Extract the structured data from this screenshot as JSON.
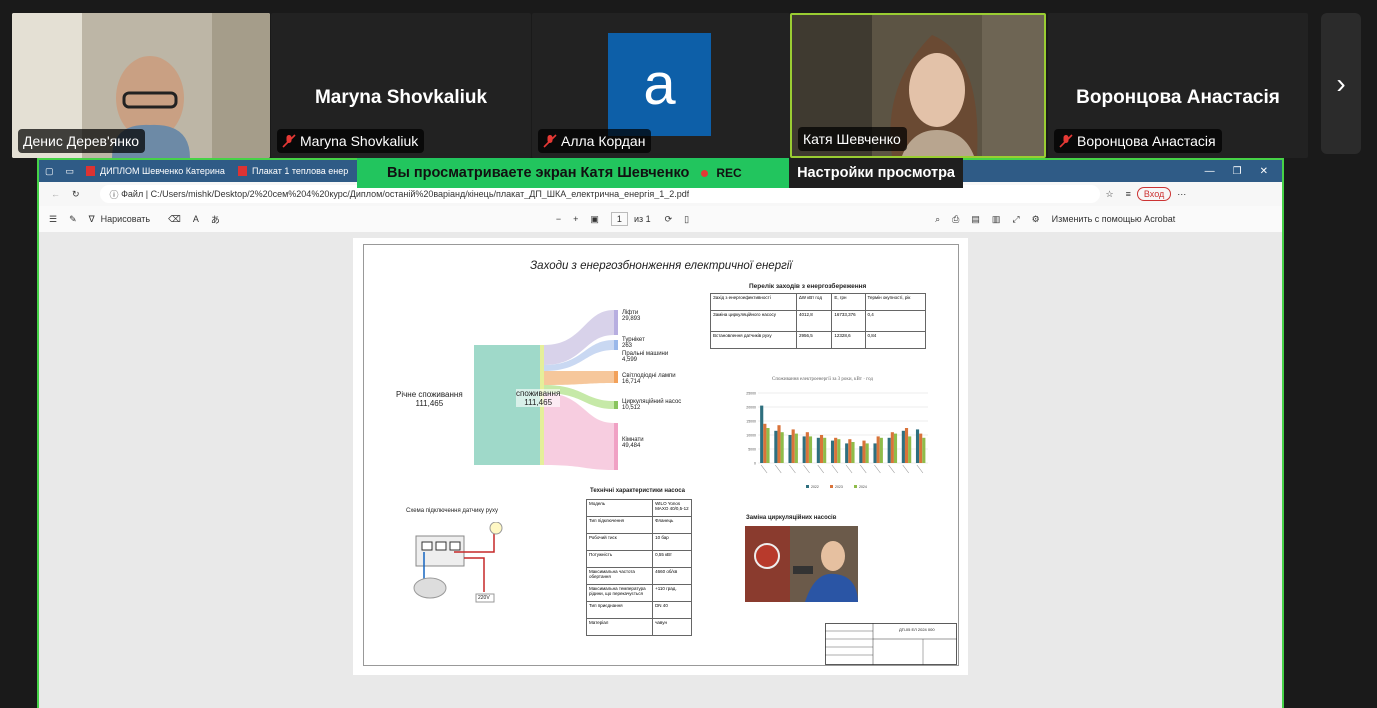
{
  "participants": [
    {
      "name": "Денис Дерев'янко",
      "muted": false
    },
    {
      "name": "Maryna Shovkaliuk",
      "muted": true,
      "display": "Maryna Shovkaliuk"
    },
    {
      "name": "Алла Кордан",
      "muted": true,
      "avatar_letter": "a"
    },
    {
      "name": "Катя Шевченко",
      "muted": false
    },
    {
      "name": "Воронцова Анастасія",
      "muted": true,
      "display": "Воронцова Анастасія"
    }
  ],
  "next_icon": "chevron-right-icon",
  "banner": {
    "text": "Вы просматриваете экран  Катя Шевченко",
    "rec": "REC",
    "settings": "Настройки просмотра"
  },
  "browser": {
    "tabs": [
      "ДИПЛОМ Шевченко Катерина",
      "Плакат 1 теплова енер"
    ],
    "url_label": "Файл",
    "url": "C:/Users/mishk/Desktop/2%20сем%204%20курс/Диплом/останій%20варіанд/кінець/плакат_ДП_ШКА_електрична_енергія_1_2.pdf",
    "login": "Вход"
  },
  "pdf_toolbar": {
    "draw": "Нарисовать",
    "page": "1",
    "of": "из 1",
    "edit": "Изменить с помощью Acrobat"
  },
  "poster": {
    "title": "Заходи з енергозбнонження електричної енергії",
    "sankey": {
      "left_label": "Річне споживання",
      "left_value": "111,465",
      "mid_label": "споживання",
      "mid_value": "111,465",
      "items": [
        {
          "label": "Ліфти",
          "value": "29,893"
        },
        {
          "label": "Турнікет",
          "value": "263"
        },
        {
          "label": "Пральні машини",
          "value": "4,599"
        },
        {
          "label": "Світлодіодні лампи",
          "value": "16,714"
        },
        {
          "label": "Циркуляційний насос",
          "value": "10,512"
        },
        {
          "label": "Кімнати",
          "value": "49,484"
        }
      ]
    },
    "measures": {
      "title": "Перелік заходів з енергозбереження",
      "headers": [
        "Захід з енергоефективності",
        "∆W кВт год",
        "Е, грн",
        "Термін окупності, рік"
      ],
      "rows": [
        [
          "Заміна циркуляційного насосу",
          "4012,8",
          "16733,376",
          "0,4"
        ],
        [
          "Встановлення датчиків руху",
          "2956,5",
          "12328,6",
          "0,84"
        ]
      ]
    },
    "chart_title": "Споживання електроенергії за 3 роки, кВт · год",
    "chart_legend": [
      "2022",
      "2023",
      "2024"
    ],
    "pump": {
      "title": "Технічні характеристики насоса",
      "rows": [
        [
          "Модель",
          "WILO Yonos MAXO 40/0,5-12"
        ],
        [
          "Тип підключення",
          "Фланець"
        ],
        [
          "Робочий тиск",
          "10 бар"
        ],
        [
          "Потужність",
          "0,55 кВт"
        ],
        [
          "Максимальна частота обертання",
          "4660 об/хв"
        ],
        [
          "Максимальна температура рідини, що перекачується",
          "+110 град."
        ],
        [
          "Тип приєднання",
          "DN 40"
        ],
        [
          "Матеріал",
          "чавун"
        ]
      ]
    },
    "sensor_title": "Схема підключення датчику руху",
    "sensor_voltage": "220V",
    "replace_title": "Заміна циркуляційних насосів",
    "stamp_code": "ДП-05 ЕЛ 2024 000"
  },
  "chart_data": {
    "type": "bar",
    "title": "Споживання електроенергії за 3 роки, кВт · год",
    "ylim": [
      0,
      25000
    ],
    "yticks": [
      "0",
      "5000",
      "10000",
      "15000",
      "20000",
      "25000"
    ],
    "categories_count": 12,
    "series": [
      {
        "name": "2022",
        "values": [
          20500,
          11500,
          10000,
          9500,
          9000,
          8000,
          7000,
          6000,
          7000,
          9000,
          11500,
          12000
        ]
      },
      {
        "name": "2023",
        "values": [
          14000,
          13500,
          12000,
          11000,
          10000,
          9000,
          8500,
          8000,
          9500,
          11000,
          12500,
          10500
        ]
      },
      {
        "name": "2024",
        "values": [
          12500,
          11000,
          10500,
          9500,
          9000,
          8500,
          7500,
          7000,
          9000,
          10500,
          9500,
          9000
        ]
      }
    ],
    "colors": [
      "#2e6f7e",
      "#d9733a",
      "#8fbc4a"
    ]
  }
}
